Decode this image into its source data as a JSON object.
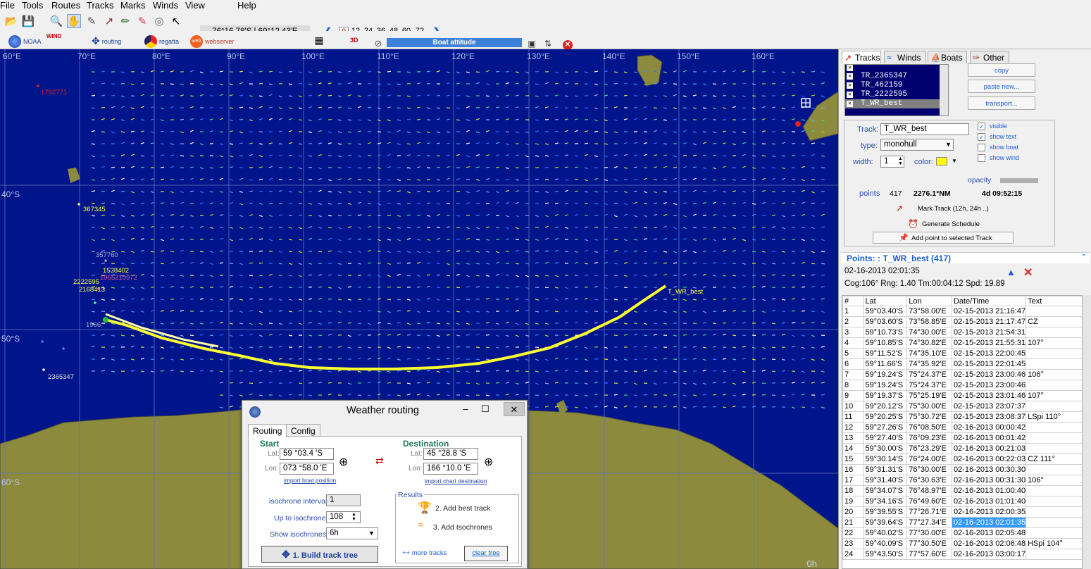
{
  "menu": [
    "File",
    "Tools",
    "Routes",
    "Tracks",
    "Marks",
    "Winds",
    "View",
    "Help"
  ],
  "toolbar": {
    "coordinates": "76°16.78'S | 69°12.43'E",
    "zoom_levels": [
      "0",
      "12",
      "24",
      "36",
      "48",
      "60",
      "72"
    ],
    "plugins": {
      "noaa": "NOAA",
      "wind": "WIND",
      "routing": "routing",
      "regatta": "regatta",
      "webserver": "webserver"
    },
    "view3d": "3D",
    "boat_attitude": "Boat attitude"
  },
  "map": {
    "lon_labels": [
      "60°E",
      "70°E",
      "80°E",
      "90°E",
      "100°E",
      "110°E",
      "120°E",
      "130°E",
      "140°E",
      "150°E",
      "160°E"
    ],
    "lat_labels": [
      "40°S",
      "50°S",
      "60°S"
    ],
    "track_labels": [
      "1792771",
      "367345",
      "357760",
      "1538402",
      "1955210972",
      "2222595",
      "2168413",
      "2365347",
      "1966",
      "T_WR_best"
    ],
    "time_label": "0h"
  },
  "weather_routing": {
    "title": "Weather routing",
    "tabs": [
      "Routing",
      "Config"
    ],
    "start_label": "Start",
    "destination_label": "Destination",
    "lat_label": "Lat:",
    "lon_label": "Lon:",
    "start_lat": "59 °03.4 'S",
    "start_lon": "073 °58.0 'E",
    "dest_lat": "45 °28.8 'S",
    "dest_lon": "166 °10.0 'E",
    "import_boat": "import boat position",
    "import_chart": "import chart destination",
    "isochrone_interval_label": "isochrone interval:",
    "isochrone_interval": "1",
    "up_to_label": "Up to isochrone:",
    "up_to": "108",
    "show_iso_label": "Show isochrones:",
    "show_iso": "6h",
    "results_label": "Results",
    "add_best": "2. Add best track",
    "add_iso": "3. Add Isochrones",
    "build_tree": "1. Build track tree",
    "more_tracks": "++ more tracks",
    "clear_tree": "clear tree"
  },
  "right_panel": {
    "tabs": [
      "Tracks",
      "Winds",
      "Boats",
      "Other"
    ],
    "tracks": [
      "TR_2365347",
      "TR_462159",
      "TR_2222595",
      "T_WR_best"
    ],
    "buttons": {
      "copy": "copy",
      "paste": "paste new...",
      "transport": "transport..."
    },
    "track_label": "Track:",
    "track_name": "T_WR_best",
    "type_label": "type:",
    "type_value": "monohull",
    "width_label": "width:",
    "width_value": "1",
    "color_label": "color:",
    "color_value": "#ffff00",
    "visible": "visible",
    "show_text": "show text",
    "show_boat": "show boat",
    "show_wind": "show wind",
    "opacity": "opacity",
    "points_label": "points",
    "points_value": "417",
    "distance": "2276.1°NM",
    "duration": "4d 09:52:15",
    "mark_track": "Mark Track (12h, 24h ..)",
    "gen_schedule": "Generate Schedule",
    "add_point": "Add point to selected Track"
  },
  "points": {
    "title": "Points: : T_WR_best (417)",
    "selected_time": "02-16-2013 02:01:35",
    "info": "Cog:106° Rng:  1.40 Tm:00:04:12 Spd: 19.89",
    "columns": [
      "#",
      "Lat",
      "Lon",
      "Date/Time",
      "Text"
    ],
    "rows": [
      [
        "1",
        "59°03.40'S",
        "73°58.00'E",
        "02-15-2013 21:16:47",
        ""
      ],
      [
        "2",
        "59°03.60'S",
        "73°58.85'E",
        "02-15-2013 21:17:47",
        "CZ"
      ],
      [
        "3",
        "59°10.73'S",
        "74°30.00'E",
        "02-15-2013 21:54:31",
        ""
      ],
      [
        "4",
        "59°10.85'S",
        "74°30.82'E",
        "02-15-2013 21:55:31",
        "107°"
      ],
      [
        "5",
        "59°11.52'S",
        "74°35.10'E",
        "02-15-2013 22:00:45",
        ""
      ],
      [
        "6",
        "59°11.66'S",
        "74°35.92'E",
        "02-15-2013 22:01:45",
        ""
      ],
      [
        "7",
        "59°19.24'S",
        "75°24.37'E",
        "02-15-2013 23:00:46",
        "106°"
      ],
      [
        "8",
        "59°19.24'S",
        "75°24.37'E",
        "02-15-2013 23:00:46",
        ""
      ],
      [
        "9",
        "59°19.37'S",
        "75°25.19'E",
        "02-15-2013 23:01:46",
        "107°"
      ],
      [
        "10",
        "59°20.12'S",
        "75°30.00'E",
        "02-15-2013 23:07:37",
        ""
      ],
      [
        "11",
        "59°20.25'S",
        "75°30.72'E",
        "02-15-2013 23:08:37",
        "LSpi 110°"
      ],
      [
        "12",
        "59°27.26'S",
        "76°08.50'E",
        "02-16-2013 00:00:42",
        ""
      ],
      [
        "13",
        "59°27.40'S",
        "76°09.23'E",
        "02-16-2013 00:01:42",
        ""
      ],
      [
        "14",
        "59°30.00'S",
        "76°23.29'E",
        "02-16-2013 00:21:03",
        ""
      ],
      [
        "15",
        "59°30.14'S",
        "76°24.00'E",
        "02-16-2013 00:22:03",
        "CZ 111°"
      ],
      [
        "16",
        "59°31.31'S",
        "76°30.00'E",
        "02-16-2013 00:30:30",
        ""
      ],
      [
        "17",
        "59°31.40'S",
        "76°30.63'E",
        "02-16-2013 00:31:30",
        "106°"
      ],
      [
        "18",
        "59°34.07'S",
        "76°48.97'E",
        "02-16-2013 01:00:40",
        ""
      ],
      [
        "19",
        "59°34.16'S",
        "76°49.60'E",
        "02-16-2013 01:01:40",
        ""
      ],
      [
        "20",
        "59°39.55'S",
        "77°26.71'E",
        "02-16-2013 02:00:35",
        ""
      ],
      [
        "21",
        "59°39.64'S",
        "77°27.34'E",
        "02-16-2013 02:01:35",
        ""
      ],
      [
        "22",
        "59°40.02'S",
        "77°30.00'E",
        "02-16-2013 02:05:48",
        ""
      ],
      [
        "23",
        "59°40.09'S",
        "77°30.50'E",
        "02-16-2013 02:06:48",
        "HSpi 104°"
      ],
      [
        "24",
        "59°43.50'S",
        "77°57.60'E",
        "02-16-2013 03:00:17",
        ""
      ]
    ],
    "selected_row": 21
  }
}
